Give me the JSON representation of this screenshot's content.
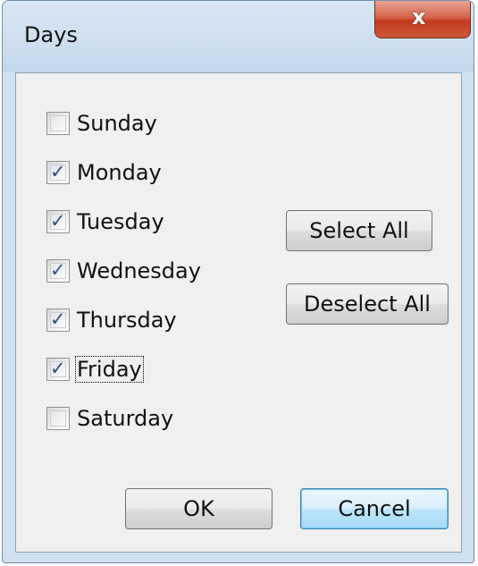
{
  "window": {
    "title": "Days",
    "close_label": "x"
  },
  "days": [
    {
      "label": "Sunday",
      "checked": false,
      "focused": false
    },
    {
      "label": "Monday",
      "checked": true,
      "focused": false
    },
    {
      "label": "Tuesday",
      "checked": true,
      "focused": false
    },
    {
      "label": "Wednesday",
      "checked": true,
      "focused": false
    },
    {
      "label": "Thursday",
      "checked": true,
      "focused": false
    },
    {
      "label": "Friday",
      "checked": true,
      "focused": true
    },
    {
      "label": "Saturday",
      "checked": false,
      "focused": false
    }
  ],
  "buttons": {
    "select_all": "Select All",
    "deselect_all": "Deselect All",
    "ok": "OK",
    "cancel": "Cancel"
  },
  "checkmark_glyph": "✓",
  "colors": {
    "frame": "#cfe0f1",
    "client": "#f0f0f0",
    "close_button": "#c03a1e",
    "checkmark": "#2f4f86",
    "default_button_border": "#3c7fb1"
  },
  "icons": {
    "close": "close-icon",
    "check": "checkmark-icon"
  }
}
